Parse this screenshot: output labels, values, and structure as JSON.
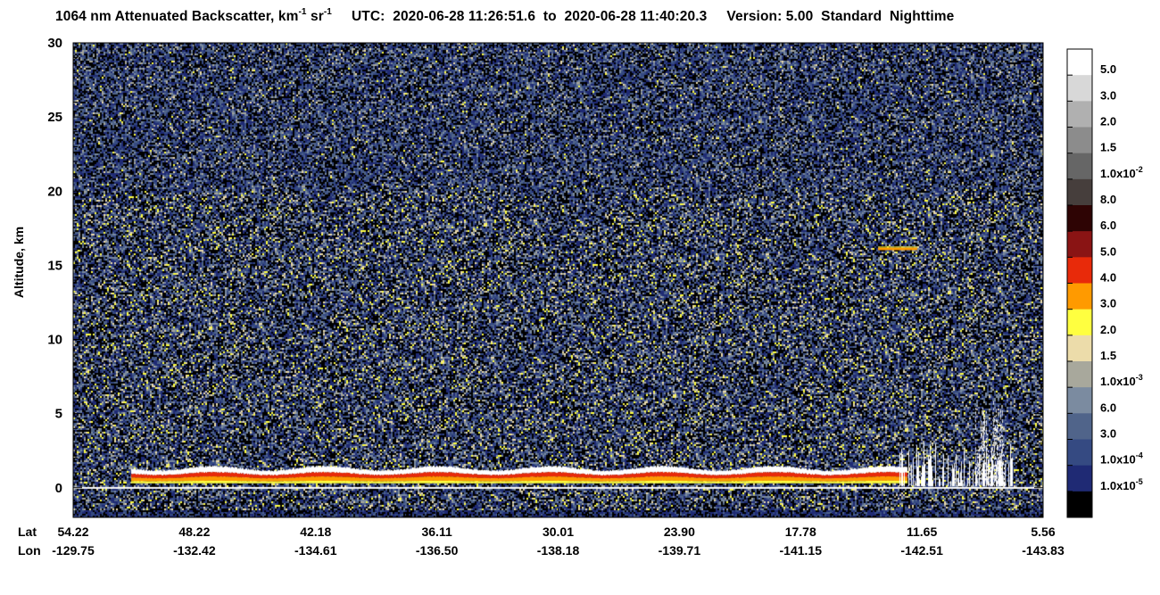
{
  "title": {
    "product": "1064 nm Attenuated Backscatter, km",
    "unit_exp1": "-1",
    "unit_sr": " sr",
    "unit_exp2": "-1",
    "utc_label": "UTC:",
    "start": "2020-06-28 11:26:51.6",
    "to": "to",
    "end": "2020-06-28 11:40:20.3",
    "version": "Version: 5.00",
    "type": "Standard",
    "mode": "Nighttime"
  },
  "chart_data": {
    "type": "heatmap",
    "ylabel": "Altitude, km",
    "ylim": [
      -2,
      30
    ],
    "yticks": [
      0,
      5,
      10,
      15,
      20,
      25,
      30
    ],
    "x_row_labels": [
      "Lat",
      "Lon"
    ],
    "xticks": [
      {
        "lat": "54.22",
        "lon": "-129.75"
      },
      {
        "lat": "48.22",
        "lon": "-132.42"
      },
      {
        "lat": "42.18",
        "lon": "-134.61"
      },
      {
        "lat": "36.11",
        "lon": "-136.50"
      },
      {
        "lat": "30.01",
        "lon": "-138.18"
      },
      {
        "lat": "23.90",
        "lon": "-139.71"
      },
      {
        "lat": "17.78",
        "lon": "-141.15"
      },
      {
        "lat": "11.65",
        "lon": "-142.51"
      },
      {
        "lat": "5.56",
        "lon": "-143.83"
      }
    ],
    "colorbar": {
      "colors": [
        "#ffffff",
        "#d8d8d8",
        "#b0b0b0",
        "#8c8c8c",
        "#666666",
        "#463e3c",
        "#2e0404",
        "#8a1414",
        "#e82a0a",
        "#ff9a00",
        "#ffff40",
        "#ecdcaa",
        "#a8a89c",
        "#7b8ba0",
        "#50648a",
        "#354a82",
        "#1f2a74",
        "#000000"
      ],
      "labels": [
        {
          "m": "5.0",
          "e": ""
        },
        {
          "m": "3.0",
          "e": ""
        },
        {
          "m": "2.0",
          "e": ""
        },
        {
          "m": "1.5",
          "e": ""
        },
        {
          "m": "1.0x10",
          "e": "-2"
        },
        {
          "m": "8.0",
          "e": ""
        },
        {
          "m": "6.0",
          "e": ""
        },
        {
          "m": "5.0",
          "e": ""
        },
        {
          "m": "4.0",
          "e": ""
        },
        {
          "m": "3.0",
          "e": ""
        },
        {
          "m": "2.0",
          "e": ""
        },
        {
          "m": "1.5",
          "e": ""
        },
        {
          "m": "1.0x10",
          "e": "-3"
        },
        {
          "m": "6.0",
          "e": ""
        },
        {
          "m": "3.0",
          "e": ""
        },
        {
          "m": "1.0x10",
          "e": "-4"
        },
        {
          "m": "1.0x10",
          "e": "-5"
        }
      ]
    },
    "features": [
      {
        "kind": "marine-boundary-layer-cloud",
        "x_from": 0.06,
        "x_to": 0.86,
        "y_top": 1.3,
        "y_base": 0.3
      },
      {
        "kind": "thin-cirrus",
        "x_from": 0.83,
        "x_to": 0.87,
        "y": 16.2
      },
      {
        "kind": "convective-tower",
        "x_from": 0.93,
        "x_to": 0.96,
        "y_top": 6.0
      }
    ]
  }
}
